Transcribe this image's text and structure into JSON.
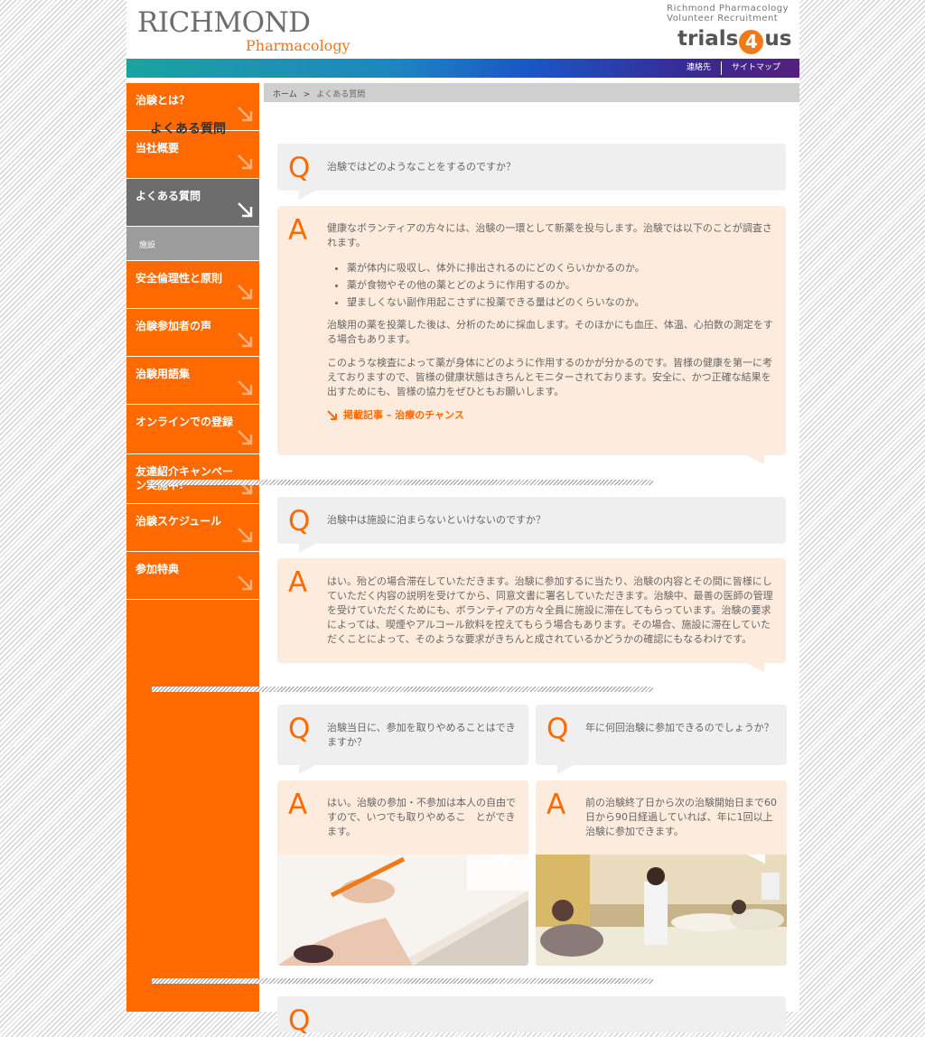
{
  "header": {
    "logo_main": "RICHMOND",
    "logo_sub": "Pharmacology",
    "tagline_1": "Richmond Pharmacology",
    "tagline_2": "Volunteer Recruitment",
    "trials_left": "trials",
    "trials_num": "4",
    "trials_right": "us"
  },
  "toplinks": {
    "contact": "連絡先",
    "sitemap": "サイトマップ"
  },
  "sidebar": {
    "items": [
      {
        "label": "治験とは？"
      },
      {
        "label": "当社概要"
      },
      {
        "label": "よくある質問"
      },
      {
        "label": "安全倫理性と原則"
      },
      {
        "label": "治験参加者の声"
      },
      {
        "label": "治験用語集"
      },
      {
        "label": "オンラインでの登録"
      },
      {
        "label": "友達紹介キャンペーン実施中!"
      },
      {
        "label": "治験スケジュール"
      },
      {
        "label": "参加特典"
      }
    ],
    "sub": "施設"
  },
  "breadcrumb": {
    "home": "ホーム",
    "sep": ">",
    "current": "よくある質問"
  },
  "page_title": "よくある質問",
  "qa": [
    {
      "q": "治験ではどのようなことをするのですか？",
      "a_intro": "健康なボランティアの方々には、治験の一環として新薬を投与します。治験では以下のことが調査されます。",
      "a_list": [
        "薬が体内に吸収し、体外に排出されるのにどのくらいかかるのか。",
        "薬が食物やその他の薬とどのように作用するのか。",
        "望ましくない副作用起こさずに投薬できる量はどのくらいなのか。"
      ],
      "a_p2": "治験用の薬を投薬した後は、分析のために採血します。そのほかにも血圧、体温、心拍数の測定をする場合もあります。",
      "a_p3": "このような検査によって薬が身体にどのように作用するのかが分かるのです。皆様の健康を第一に考えておりますので、皆様の健康状態はきちんとモニターされております。安全に、かつ正確な結果を出すためにも、皆様の協力をぜひともお願いします。",
      "link": "掲載記事 – 治療のチャンス"
    },
    {
      "q": "治験中は施設に泊まらないといけないのですか？",
      "a": "はい。殆どの場合滞在していただきます。治験に参加するに当たり、治験の内容とその間に皆様にしていただく内容の説明を受けてから、同意文書に署名していただきます。治験中、最善の医師の管理を受けていただくためにも、ボランティアの方々全員に施設に滞在してもらっています。治験の要求によっては、喫煙やアルコール飲料を控えてもらう場合もあります。その場合、施設に滞在していただくことによって、そのような要求がきちんと成されているかどうかの確認にもなるわけです。"
    },
    {
      "q": "治験当日に、参加を取りやめることはできますか？",
      "a": "はい。治験の参加・不参加は本人の自由ですので、いつでも取りやめるこ　とができます。"
    },
    {
      "q": "年に何回治験に参加できるのでしょうか？",
      "a": "前の治験終了日から次の治験開始日まで60日から90日経過していれば、年に1回以上治験に参加できます。"
    }
  ],
  "letters": {
    "q": "Q",
    "a": "A"
  },
  "colors": {
    "accent": "#ff6a00",
    "nav_active": "#6d6d6d",
    "answer_bg": "#fdebdd",
    "question_bg": "#efefef"
  }
}
